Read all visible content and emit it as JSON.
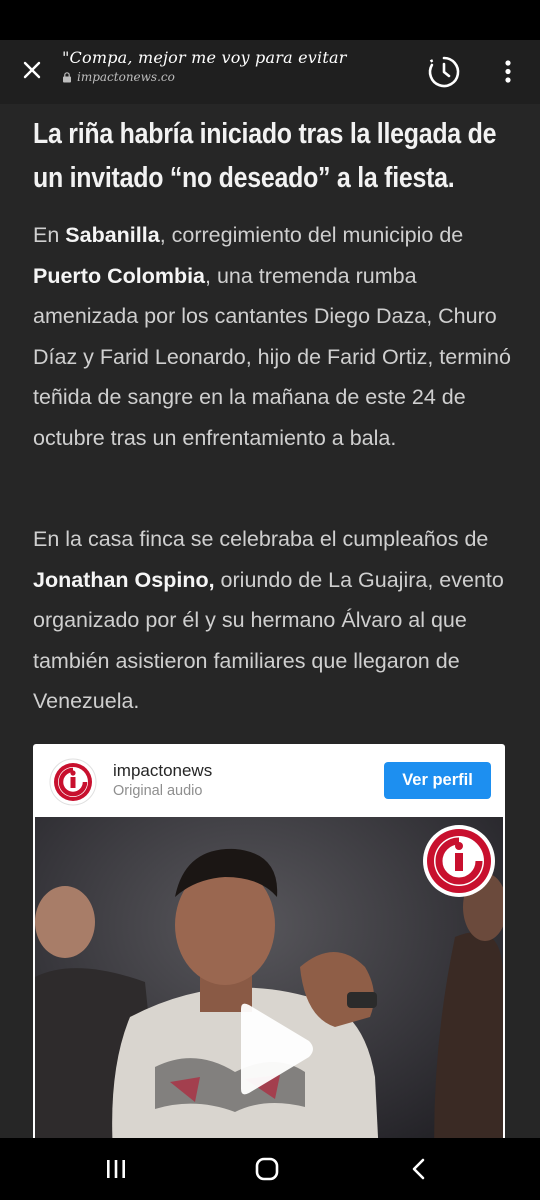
{
  "topbar": {
    "title": "\"Compa, mejor me voy para evitar",
    "url": "impactonews.co",
    "icons": [
      "close-icon",
      "lock-icon",
      "history-icon",
      "more-vert-icon"
    ]
  },
  "article": {
    "heading_line1": "La riña habría iniciado tras la llegada de",
    "heading_line2": "un invitado “no deseado” a la fiesta.",
    "p1": {
      "t1": "En ",
      "b1": "Sabanilla",
      "t2": ", corregimiento del municipio de ",
      "b2": "Puerto Colombia",
      "t3": ", una tremenda rumba amenizada por los cantantes Diego Daza, Churo Díaz y Farid Leonardo, hijo de Farid Ortiz, terminó teñida de sangre en la mañana de este 24 de octubre tras un enfrentamiento a bala."
    },
    "p2": {
      "t1": "En la casa finca se celebraba el cumpleaños de ",
      "b1": "Jonathan Ospino,",
      "t2": " oriundo de La Guajira, evento organizado por él y su hermano Álvaro al que también asistieron familiares que llegaron de Venezuela."
    }
  },
  "embed": {
    "account": "impactonews",
    "subtitle": "Original audio",
    "profile_button": "Ver perfil",
    "brand_color": "#c8102e",
    "button_color": "#1d8ff0"
  },
  "navbar": {
    "icons": [
      "recent-apps-icon",
      "home-icon",
      "back-icon"
    ]
  }
}
